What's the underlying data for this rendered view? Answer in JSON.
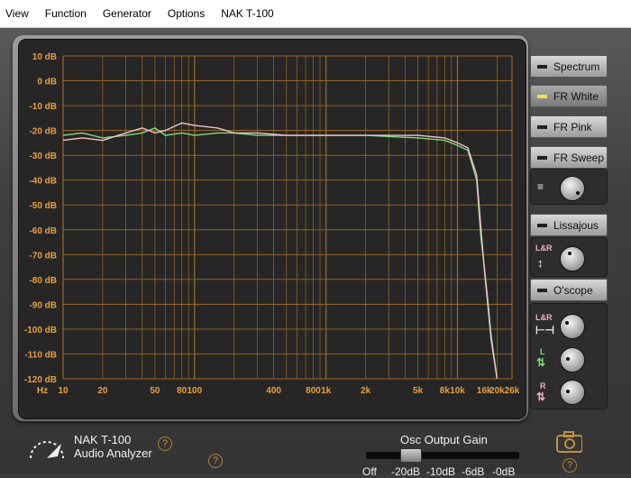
{
  "menu": [
    "View",
    "Function",
    "Generator",
    "Options",
    "NAK T-100"
  ],
  "chart_data": {
    "type": "line",
    "title": "",
    "xlabel": "Hz",
    "ylabel": "",
    "x_scale": "log",
    "xlim": [
      10,
      26000
    ],
    "ylim": [
      -120,
      10
    ],
    "y_ticks": [
      10,
      0,
      -10,
      -20,
      -30,
      -40,
      -50,
      -60,
      -70,
      -80,
      -90,
      -100,
      -110,
      -120
    ],
    "y_tick_labels": [
      "10 dB",
      "0 dB",
      "-10 dB",
      "-20 dB",
      "-30 dB",
      "-40 dB",
      "-50 dB",
      "-60 dB",
      "-70 dB",
      "-80 dB",
      "-90 dB",
      "-100 dB",
      "-110 dB",
      "-120 dB"
    ],
    "x_ticks": [
      10,
      20,
      50,
      80,
      100,
      400,
      800,
      1000,
      2000,
      5000,
      8000,
      10000,
      16000,
      20000,
      26000
    ],
    "x_tick_labels": [
      "10",
      "20",
      "50",
      "80",
      "100",
      "400",
      "800",
      "1k",
      "2k",
      "5k",
      "8k",
      "10k",
      "16k",
      "20k",
      "26k"
    ],
    "grid": true,
    "series": [
      {
        "color": "#7ddc7a",
        "x": [
          10,
          14,
          20,
          30,
          40,
          50,
          60,
          80,
          100,
          150,
          200,
          300,
          500,
          1000,
          2000,
          5000,
          8000,
          10000,
          12000,
          14000,
          15000,
          16000,
          17000,
          18000,
          20000
        ],
        "y": [
          -22,
          -21,
          -23,
          -22,
          -21,
          -19,
          -22,
          -21,
          -22,
          -21,
          -21,
          -22,
          -22,
          -22,
          -22,
          -23,
          -24,
          -26,
          -28,
          -40,
          -62,
          -75,
          -88,
          -102,
          -120
        ]
      },
      {
        "color": "#f2c0cc",
        "x": [
          10,
          14,
          20,
          30,
          40,
          50,
          60,
          80,
          100,
          150,
          200,
          300,
          500,
          1000,
          2000,
          5000,
          8000,
          10000,
          12000,
          14000,
          15000,
          16000,
          17000,
          18000,
          20000
        ],
        "y": [
          -24,
          -23,
          -24,
          -21,
          -19,
          -21,
          -20,
          -17,
          -18,
          -19,
          -21,
          -21,
          -22,
          -22,
          -22,
          -22,
          -23,
          -25,
          -27,
          -38,
          -58,
          -76,
          -90,
          -104,
          -120
        ]
      }
    ]
  },
  "panel": {
    "spectrum": "Spectrum",
    "fr_white": "FR White",
    "fr_pink": "FR Pink",
    "fr_sweep": "FR Sweep",
    "lissajous": "Lissajous",
    "oscope": "O'scope",
    "lr_label": "L&R",
    "l_label": "L",
    "r_label": "R"
  },
  "footer": {
    "brand": "NAK  T-100",
    "product": "Audio Analyzer",
    "help": "?",
    "osc_label": "Osc Output Gain",
    "gain_ticks": [
      "Off",
      "-20dB",
      "-10dB",
      "-6dB",
      "-0dB"
    ]
  },
  "colors": {
    "grid": "#a06a1e",
    "axis_text": "#e8a040",
    "active_led": "#f0e040"
  }
}
